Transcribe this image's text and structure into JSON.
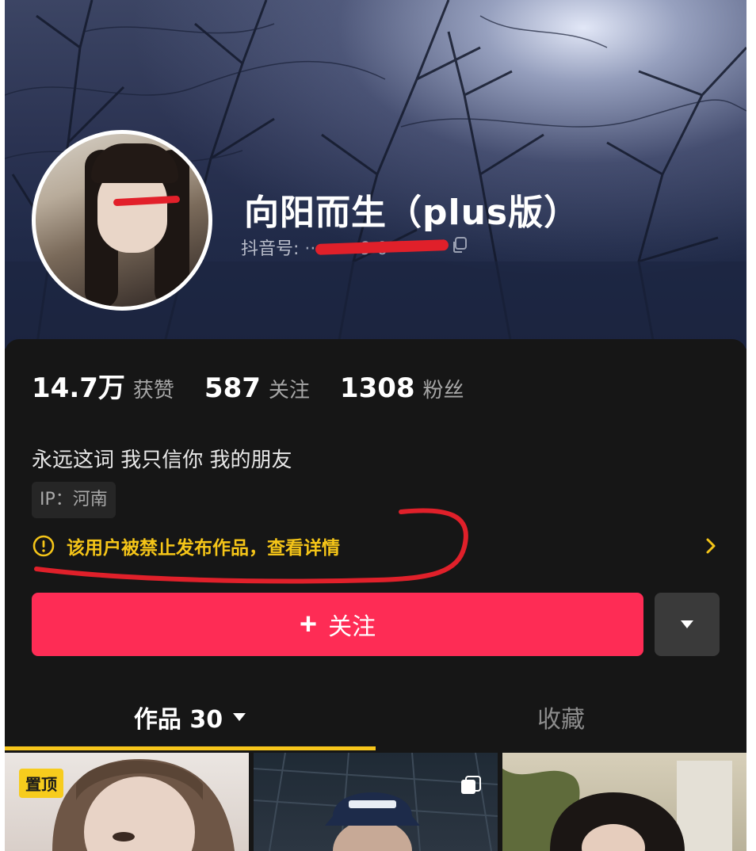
{
  "profile": {
    "nickname": "向阳而生（plus版）",
    "douyin_id_label": "抖音号:",
    "douyin_id_value": "··········9·0·"
  },
  "stats": [
    {
      "value": "14.7万",
      "label": "获赞"
    },
    {
      "value": "587",
      "label": "关注"
    },
    {
      "value": "1308",
      "label": "粉丝"
    }
  ],
  "bio": "永远这词 我只信你 我的朋友",
  "ip": "IP：河南",
  "warning": {
    "text": "该用户被禁止发布作品，查看详情",
    "icon": "exclamation-circle-icon"
  },
  "actions": {
    "follow_plus": "+",
    "follow_label": "关注",
    "more_icon": "triangle-down-icon"
  },
  "tabs": {
    "works_label": "作品 30",
    "favorites_label": "收藏"
  },
  "grid": {
    "pinned_badge": "置顶"
  },
  "colors": {
    "accent": "#fe2c55",
    "warning": "#f5c518",
    "tab_indicator": "#f7c61b",
    "annotation_red": "#e0202a"
  }
}
